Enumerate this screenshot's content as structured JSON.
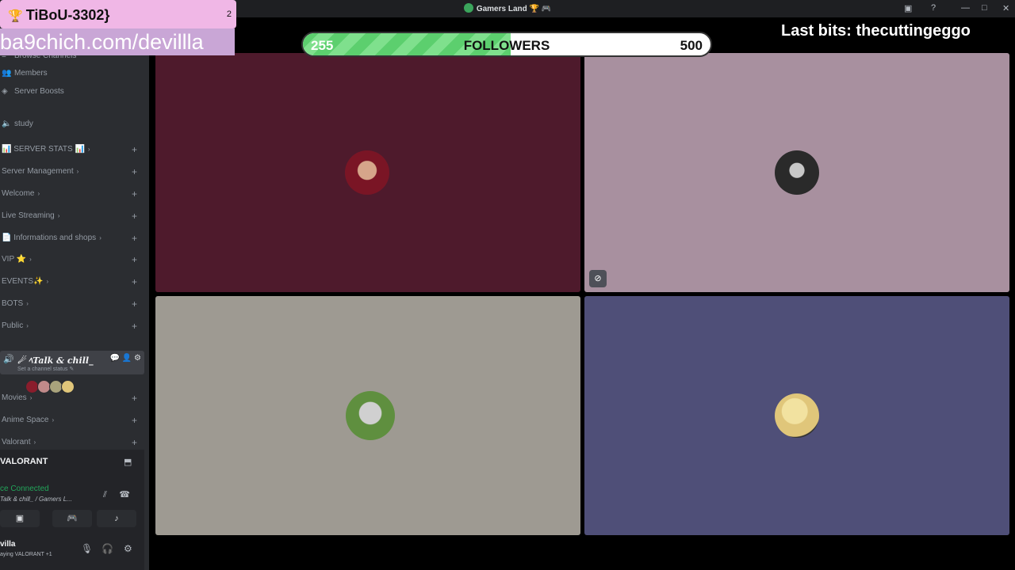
{
  "window": {
    "title": "Gamers Land 🏆 🎮",
    "buttons": {
      "inbox": "▣",
      "help": "?",
      "minimize": "—",
      "maximize": "□",
      "close": "✕"
    }
  },
  "sidebar": {
    "browse": "Browse Channels",
    "members": "Members",
    "boosts": "Server Boosts",
    "study": "study",
    "categories": [
      "📊 SERVER STATS 📊",
      "Server Management",
      "Welcome",
      "Live Streaming",
      "📄 Informations and shops",
      "VIP ⭐",
      "EVENTS✨",
      "BOTS",
      "Public"
    ],
    "active_channel": {
      "name": "☄ ﾍTalk & chill_",
      "status": "Set a channel status ✎"
    },
    "categories2": [
      "Movies",
      "Anime Space",
      "Valorant"
    ],
    "avatar_colors": [
      "#8a1d2c",
      "#c08a8a",
      "#a9a37c",
      "#e0c67a"
    ]
  },
  "userpanel": {
    "game": "VALORANT",
    "voice_connected": "ce Connected",
    "voice_sub": "Talk & chill_ / Gamers L...",
    "user": "villa",
    "activity": "aying VALORANT +1"
  },
  "tiles": [
    {
      "bg": "#4e1a2c",
      "avatar": "#7a1525"
    },
    {
      "bg": "#a8909f",
      "avatar": "#2a2a2a"
    },
    {
      "bg": "#9e9a92",
      "avatar": "#5f8f3f"
    },
    {
      "bg": "#4f4f78",
      "avatar": "#e0c67a"
    }
  ],
  "overlay": {
    "user": "TiBoU-3302}",
    "count": "2",
    "url": "ba9chich.com/devillla",
    "followers_label": "FOLLOWERS",
    "followers_current": "255",
    "followers_goal": "500",
    "followers_fraction": 0.51,
    "last_bits": "Last bits: thecuttingeggo"
  }
}
